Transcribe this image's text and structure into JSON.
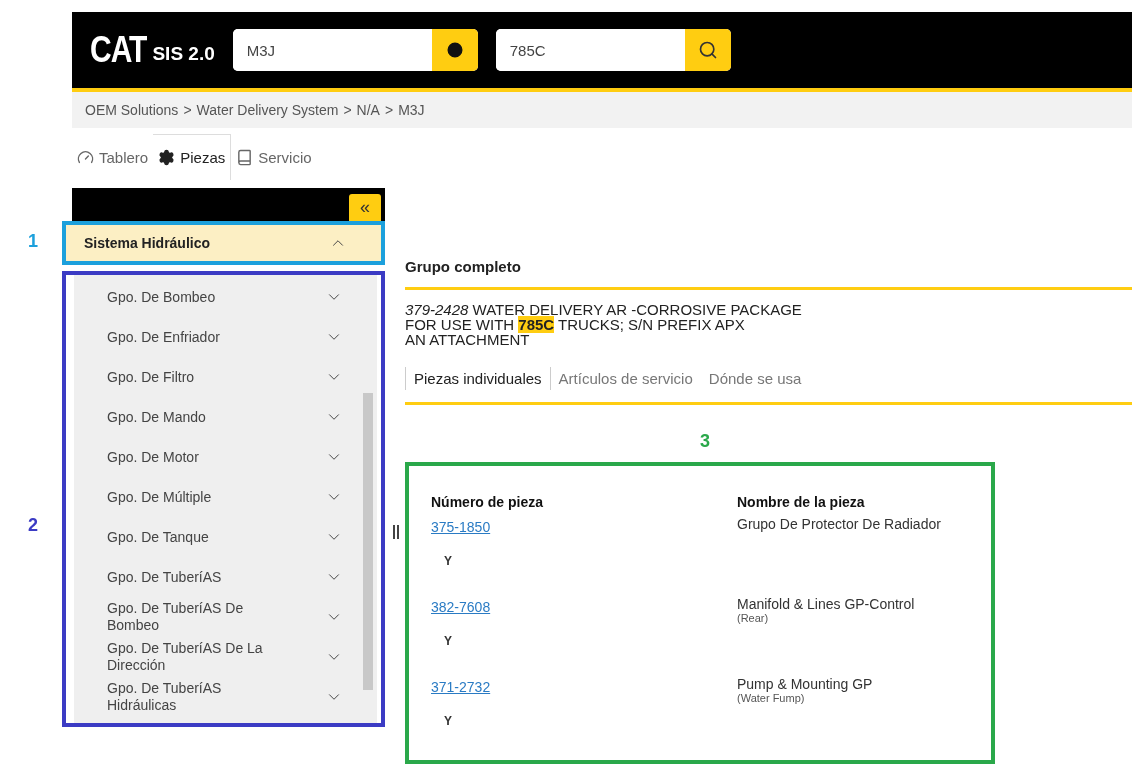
{
  "header": {
    "logo": "CAT",
    "product": "SIS 2.0",
    "serial_field": {
      "value": "M3J"
    },
    "model_field": {
      "value": "785C"
    }
  },
  "breadcrumb": [
    "OEM Solutions",
    "Water Delivery System",
    "N/A",
    "M3J"
  ],
  "breadcrumb_separator": ">",
  "tabs": [
    {
      "label": "Tablero",
      "selected": false
    },
    {
      "label": "Piezas",
      "selected": true
    },
    {
      "label": "Servicio",
      "selected": false
    }
  ],
  "sidebar": {
    "collapse_button": "«",
    "section": {
      "title": "Sistema Hidráulico",
      "expanded": true
    },
    "items": [
      {
        "label": "Gpo. De Bombeo",
        "expanded": false
      },
      {
        "label": "Gpo. De Enfriador",
        "expanded": false
      },
      {
        "label": "Gpo. De Filtro",
        "expanded": false
      },
      {
        "label": "Gpo. De Mando",
        "expanded": false
      },
      {
        "label": "Gpo. De Motor",
        "expanded": false
      },
      {
        "label": "Gpo. De Múltiple",
        "expanded": false
      },
      {
        "label": "Gpo. De Tanque",
        "expanded": false
      },
      {
        "label": "Gpo. De TuberíAS",
        "expanded": false
      },
      {
        "label": "Gpo. De TuberíAS De Bombeo",
        "expanded": false
      },
      {
        "label": "Gpo. De TuberíAS De La Dirección",
        "expanded": false
      },
      {
        "label": "Gpo. De TuberíAS Hidráulicas",
        "expanded": false
      }
    ]
  },
  "main": {
    "title": "Grupo completo",
    "description": "*379-2428* WATER DELIVERY AR -CORROSIVE PACKAGE\nFOR USE WITH **785C** TRUCKS; S/N PREFIX APX\nAN ATTACHMENT",
    "tabs": [
      {
        "label": "Piezas individuales",
        "selected": true
      },
      {
        "label": "Artículos de servicio",
        "selected": false
      },
      {
        "label": "Dónde se usa",
        "selected": false
      }
    ],
    "table": {
      "columns": [
        "Número de pieza",
        "Nombre de la pieza"
      ],
      "rows": [
        {
          "number": "375-1850",
          "name": "Grupo De Protector De Radiador",
          "connector": "Y"
        },
        {
          "number": "382-7608",
          "name": "Manifold & Lines GP-Control",
          "note": "(Rear)",
          "connector": "Y"
        },
        {
          "number": "371-2732",
          "name": "Pump & Mounting GP",
          "note": "(Water Fump)",
          "connector": "Y"
        }
      ]
    }
  },
  "annotations": [
    {
      "label": "1",
      "color": "#1ca0dc"
    },
    {
      "label": "2",
      "color": "#3b3bc4"
    },
    {
      "label": "3",
      "color": "#2aa84a"
    }
  ]
}
